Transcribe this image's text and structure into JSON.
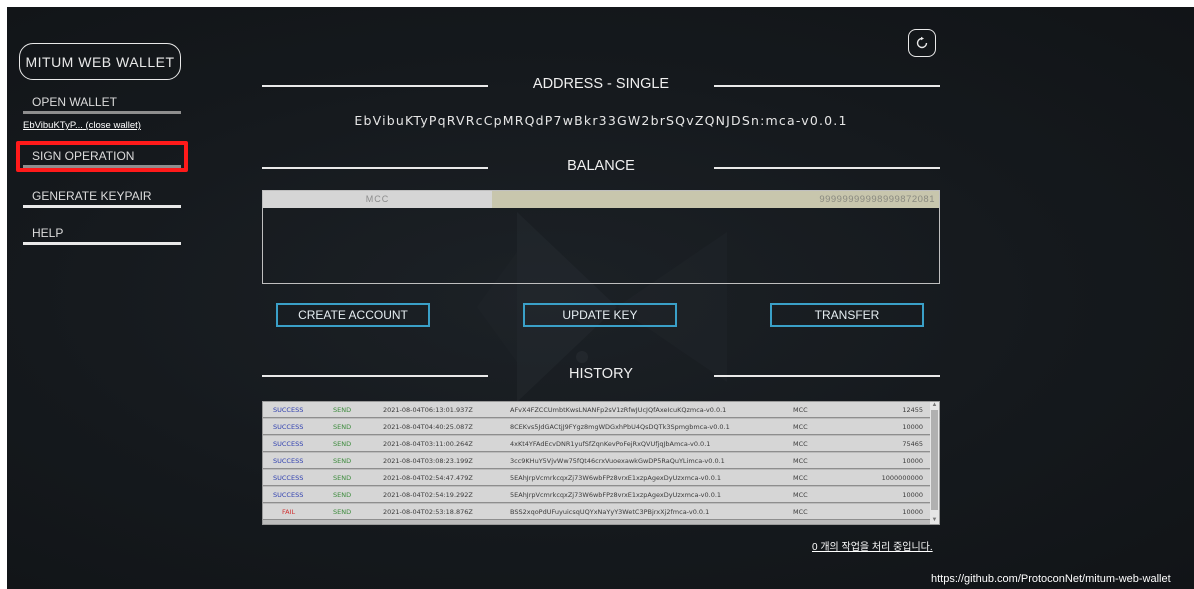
{
  "sidebar": {
    "brand": "MITUM WEB WALLET",
    "items": [
      {
        "label": "OPEN WALLET"
      },
      {
        "label": "SIGN OPERATION"
      },
      {
        "label": "GENERATE KEYPAIR"
      },
      {
        "label": "HELP"
      }
    ],
    "wallet_short": "EbVibuKTyP...",
    "close_wallet": "(close wallet)"
  },
  "header": {
    "refresh_icon": "refresh-icon"
  },
  "address_section": {
    "title": "ADDRESS - SINGLE",
    "address": "EbVibuKTyPqRVRcCpMRQdP7wBkr33GW2brSQvZQNJDSn:mca-v0.0.1"
  },
  "balance_section": {
    "title": "BALANCE",
    "rows": [
      {
        "currency": "MCC",
        "amount": "99999999998999872081"
      }
    ]
  },
  "actions": {
    "create_account": "CREATE ACCOUNT",
    "update_key": "UPDATE KEY",
    "transfer": "TRANSFER"
  },
  "history_section": {
    "title": "HISTORY",
    "rows": [
      {
        "status": "SUCCESS",
        "type": "SEND",
        "time": "2021-08-04T06:13:01.937Z",
        "hash": "AFvX4FZCCUmbtKwsLNANFp2sV1zRfwJUcJQfAxeIcuKQzmca-v0.0.1",
        "currency": "MCC",
        "amount": "12455"
      },
      {
        "status": "SUCCESS",
        "type": "SEND",
        "time": "2021-08-04T04:40:25.087Z",
        "hash": "8CEKvs5JdGACtjJ9FYgz8mgWDGxhPbU4QsDQTk3Spmgbmca-v0.0.1",
        "currency": "MCC",
        "amount": "10000"
      },
      {
        "status": "SUCCESS",
        "type": "SEND",
        "time": "2021-08-04T03:11:00.264Z",
        "hash": "4xKt4YFAdEcvDNR1yufSfZqnKevPoFejRxQVUfjqJbAmca-v0.0.1",
        "currency": "MCC",
        "amount": "75465"
      },
      {
        "status": "SUCCESS",
        "type": "SEND",
        "time": "2021-08-04T03:08:23.199Z",
        "hash": "3cc9KHuY5VjvWw75fQt46crxVuoexawkGwDP5RaQuYLimca-v0.0.1",
        "currency": "MCC",
        "amount": "10000"
      },
      {
        "status": "SUCCESS",
        "type": "SEND",
        "time": "2021-08-04T02:54:47.479Z",
        "hash": "5EAhJrpVcmrkcqxZj73W6wbFPz8vrxE1xzpAgexDyUzxmca-v0.0.1",
        "currency": "MCC",
        "amount": "1000000000"
      },
      {
        "status": "SUCCESS",
        "type": "SEND",
        "time": "2021-08-04T02:54:19.292Z",
        "hash": "5EAhJrpVcmrkcqxZj73W6wbFPz8vrxE1xzpAgexDyUzxmca-v0.0.1",
        "currency": "MCC",
        "amount": "10000"
      },
      {
        "status": "FAIL",
        "type": "SEND",
        "time": "2021-08-04T02:53:18.876Z",
        "hash": "BSS2xqoPdUFuyuicsqUQYxNaYyY3WetC3PBjrxXj2fmca-v0.0.1",
        "currency": "MCC",
        "amount": "10000"
      }
    ]
  },
  "footer": {
    "queue_status": "0 개의 작업을 처리 중입니다.",
    "url": "https://github.com/ProtoconNet/mitum-web-wallet"
  }
}
